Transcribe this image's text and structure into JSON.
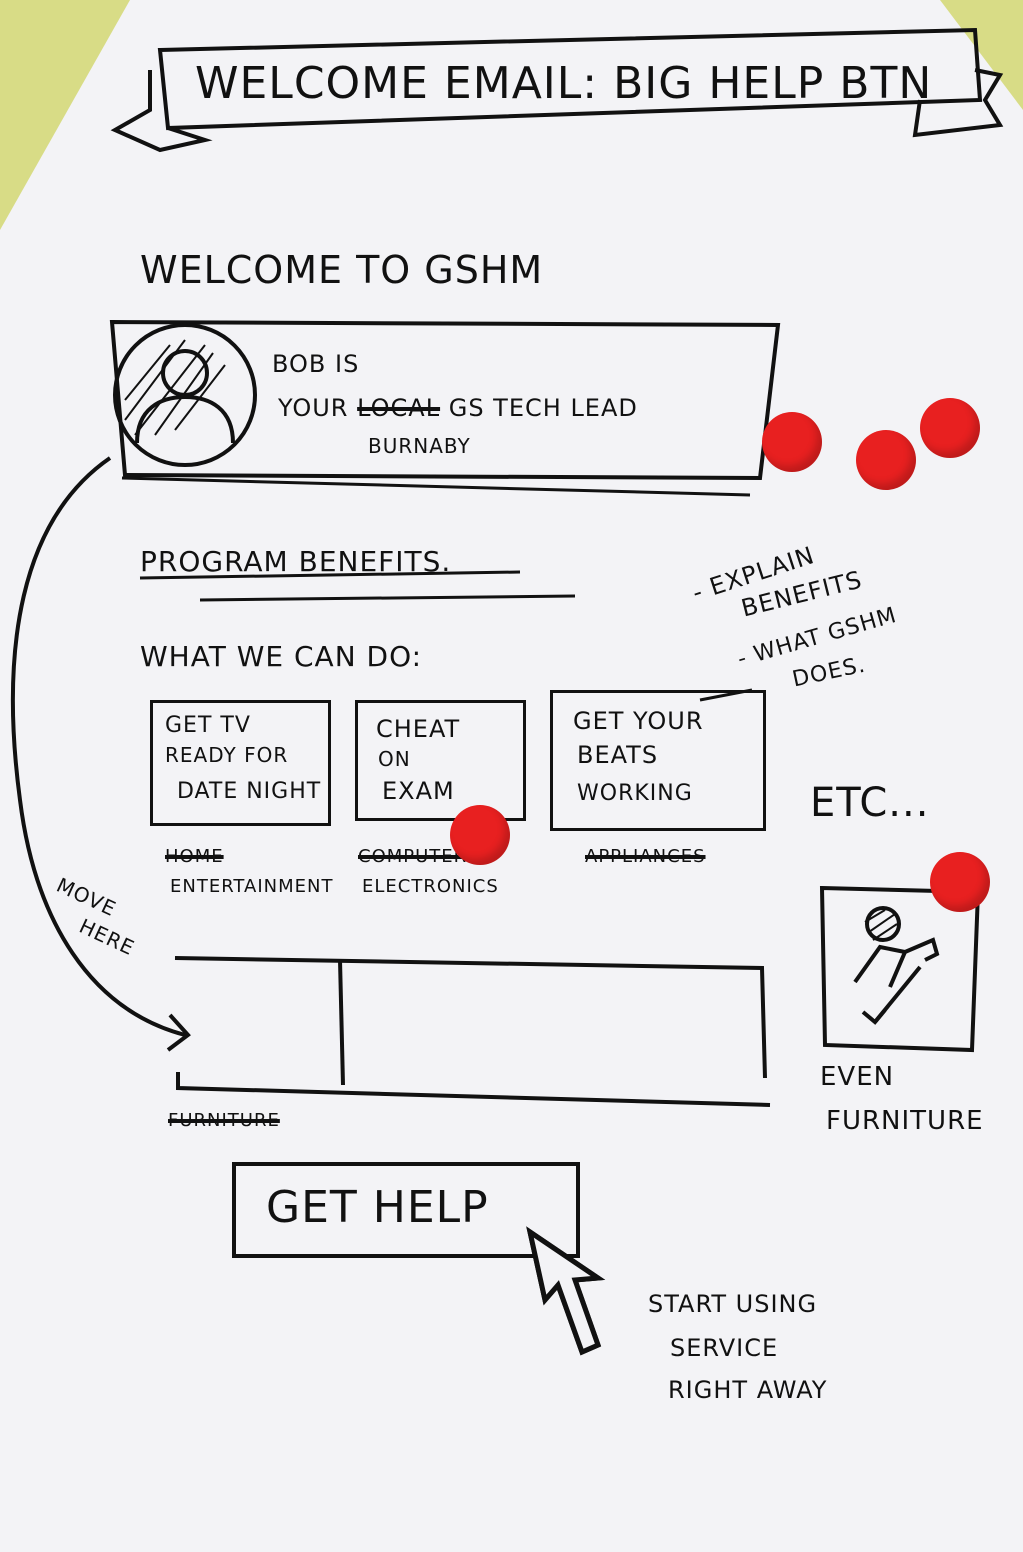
{
  "title": "WELCOME EMAIL: BIG HELP BTN",
  "welcome_heading": "WELCOME TO GSHM",
  "tech_lead": {
    "line1": "BOB IS",
    "line2_prefix": "YOUR",
    "struck_word": "LOCAL",
    "line2_suffix": "GS TECH LEAD",
    "line3": "BURNABY"
  },
  "benefits_heading": "PROGRAM BENEFITS.",
  "can_do_label": "WHAT WE CAN DO:",
  "note_benefits": [
    "- EXPLAIN",
    "BENEFITS",
    "- WHAT GSHM",
    "DOES."
  ],
  "cards": [
    {
      "lines": [
        "GET TV",
        "READY FOR",
        "DATE NIGHT"
      ],
      "struck": "HOME",
      "category": "ENTERTAINMENT"
    },
    {
      "lines": [
        "CHEAT",
        "ON",
        "EXAM"
      ],
      "struck": "COMPUTER",
      "category": "ELECTRONICS"
    },
    {
      "lines": [
        "GET YOUR",
        "BEATS",
        "WORKING"
      ],
      "struck": "APPLIANCES",
      "category": ""
    }
  ],
  "etc_label": "ETC...",
  "move_note": [
    "MOVE",
    "HERE"
  ],
  "struck_furniture": "FURNITURE",
  "even_furniture": [
    "EVEN",
    "FURNITURE"
  ],
  "cta_label": "GET HELP",
  "cta_note": [
    "START USING",
    "SERVICE",
    "RIGHT AWAY"
  ],
  "colors": {
    "ink": "#111111",
    "paper": "#f3f3f6",
    "sticker": "#e82020",
    "backing": "#d8dc86"
  },
  "icons": [
    "person-avatar-icon",
    "repair-wrench-icon",
    "mouse-cursor-icon"
  ]
}
